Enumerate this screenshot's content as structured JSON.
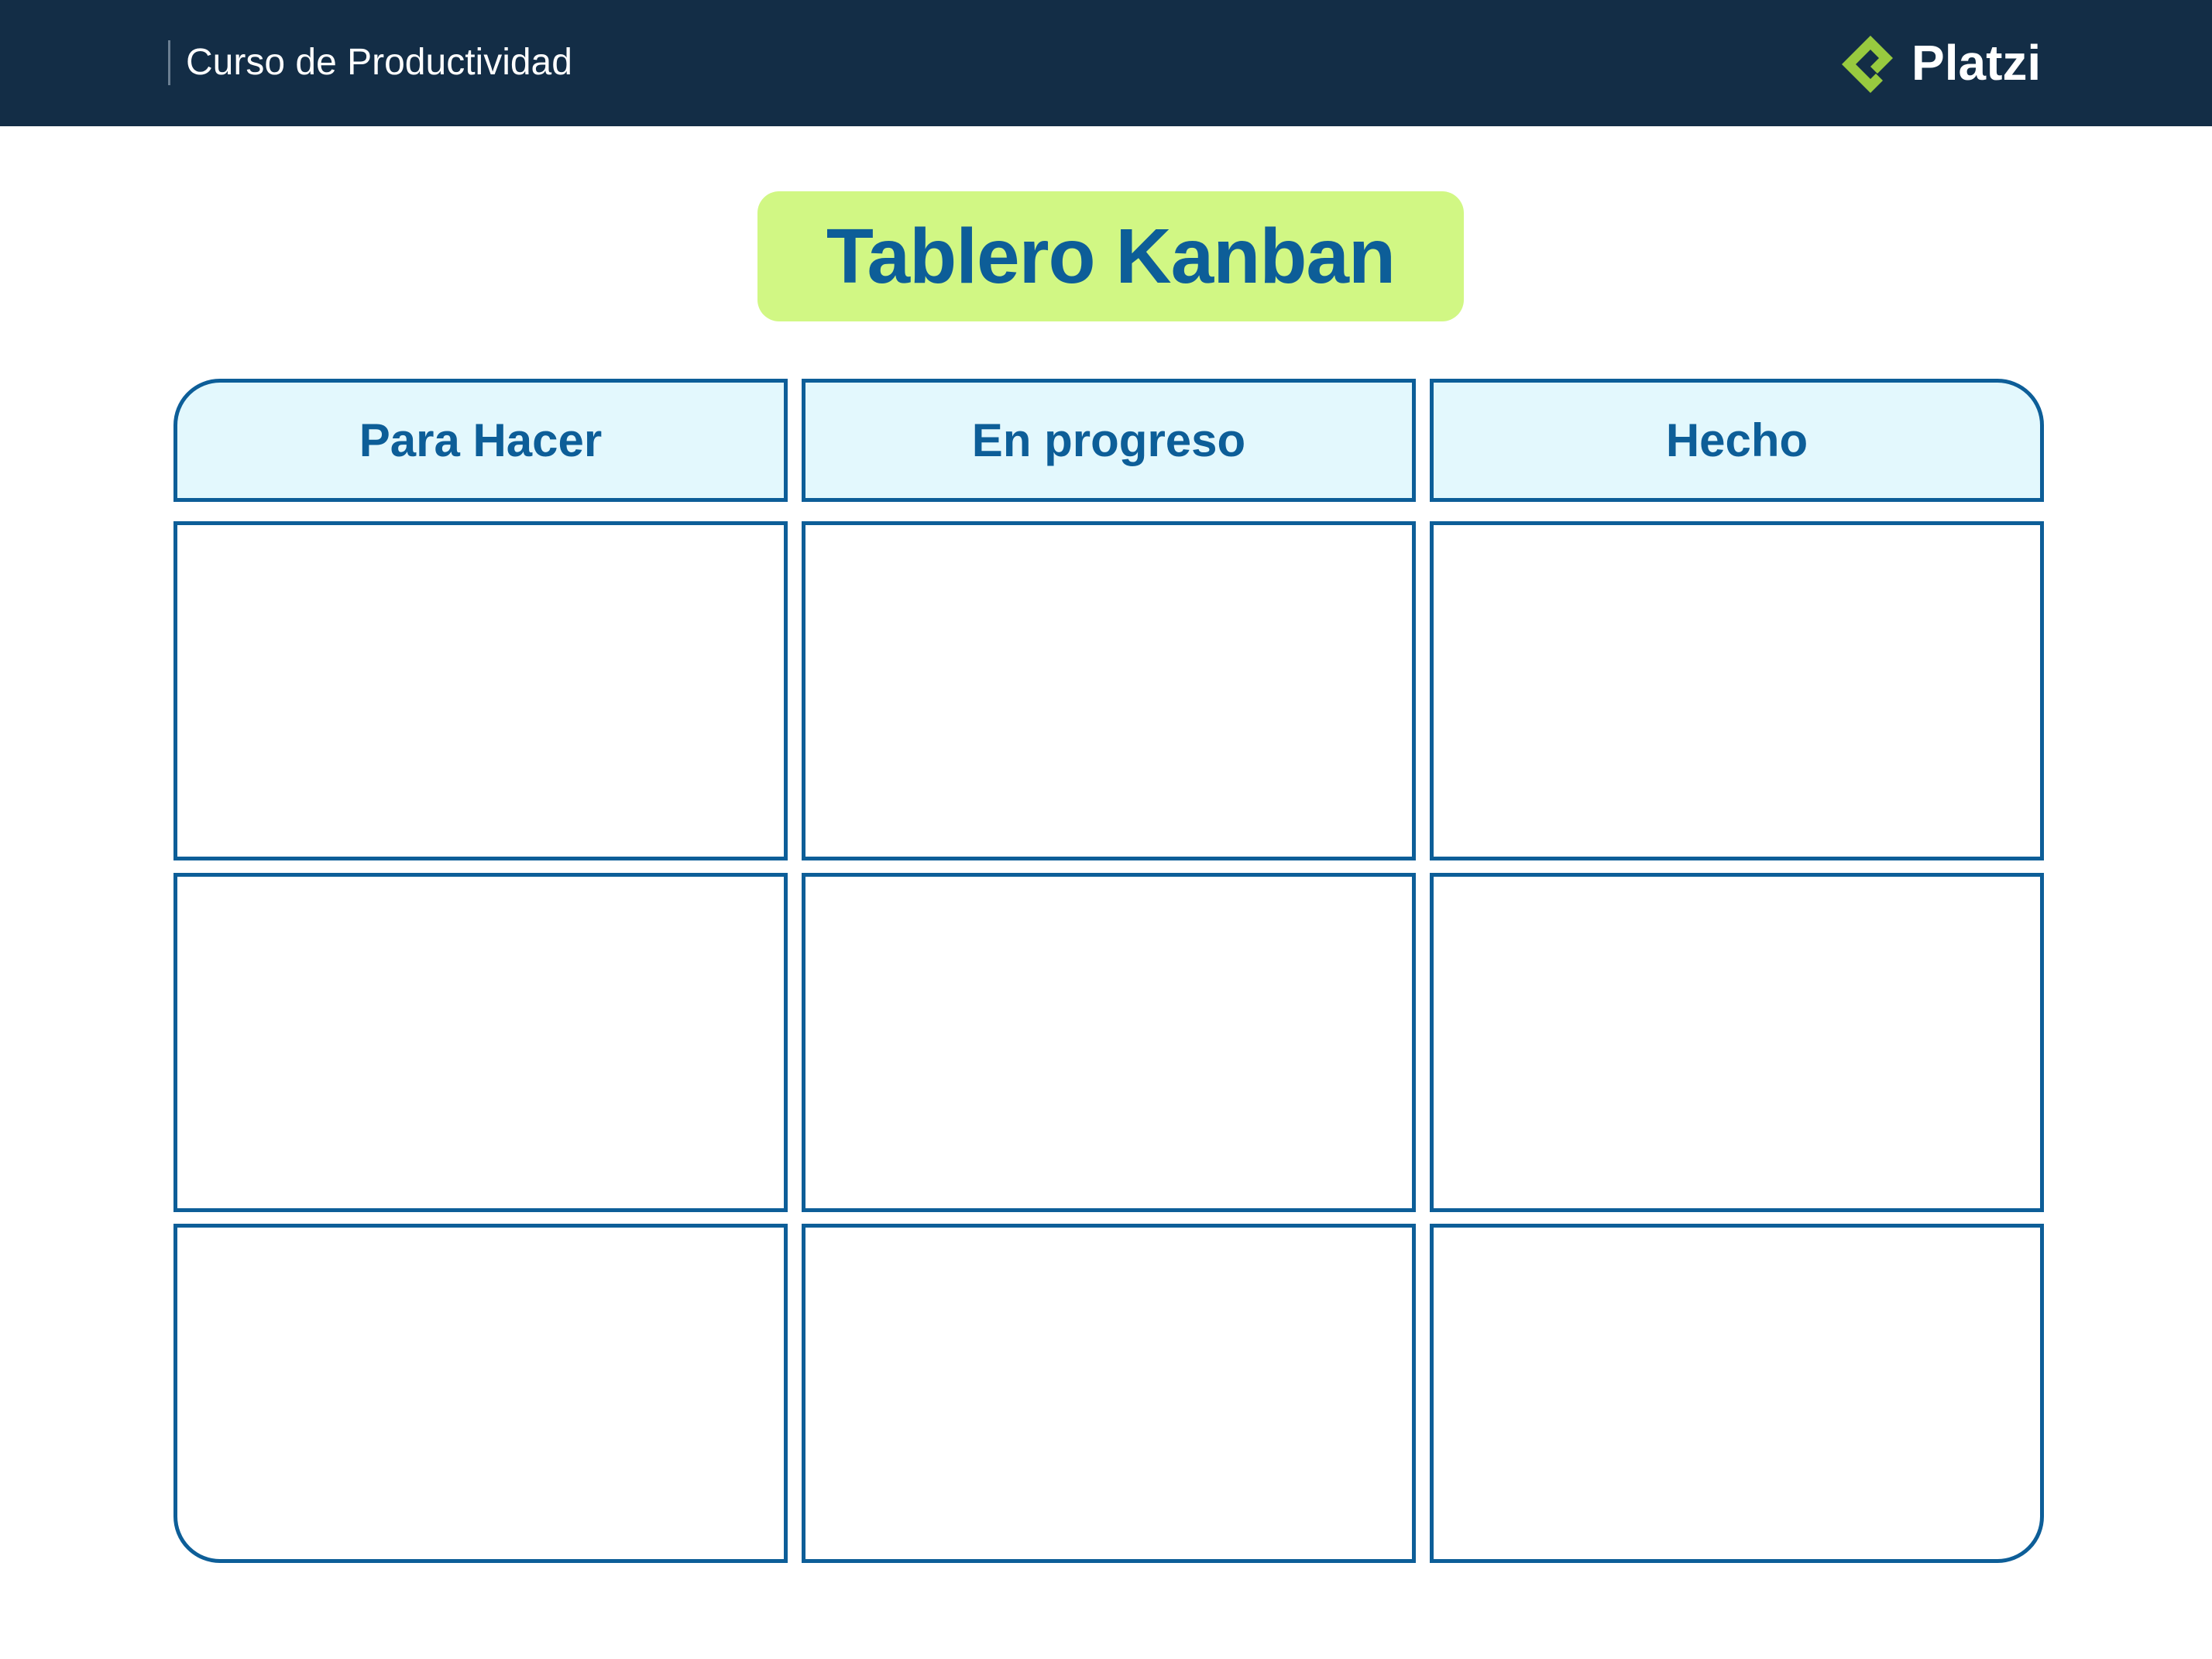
{
  "header": {
    "course_title": "Curso de Productividad",
    "logo_text": "Platzi",
    "logo_icon": "platzi-logo-icon",
    "background_color": "#132d46",
    "logo_color": "#98ca3f"
  },
  "board": {
    "title": "Tablero Kanban",
    "title_bg_color": "#d1f784",
    "accent_color": "#0d5e98",
    "header_bg_color": "#e3f8fd",
    "columns": [
      {
        "label": "Para Hacer"
      },
      {
        "label": "En progreso"
      },
      {
        "label": "Hecho"
      }
    ],
    "rows": 3
  }
}
